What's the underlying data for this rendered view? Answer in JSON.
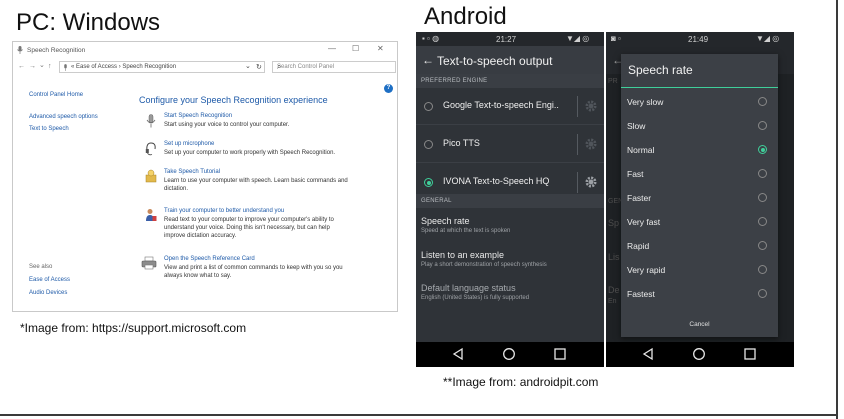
{
  "headings": {
    "pc": "PC: Windows",
    "android": "Android"
  },
  "credits": {
    "microsoft": "*Image from: https://support.microsoft.com",
    "androidpit": "**Image from: androidpit.com"
  },
  "windows": {
    "title": "Speech Recognition",
    "controls": {
      "minimize": "—",
      "maximize": "☐",
      "close": "✕"
    },
    "nav": {
      "back": "←",
      "forward": "→",
      "dropdown": "⌄",
      "up": "↑"
    },
    "breadcrumb": "« Ease of Access  ›  Speech Recognition",
    "breadcrumb_dropdown": "⌄",
    "refresh": "↻",
    "search_placeholder": "Search Control Panel",
    "help": "?",
    "sidebar": {
      "home": "Control Panel Home",
      "advanced": "Advanced speech options",
      "tts": "Text to Speech",
      "see_also": "See also",
      "ease": "Ease of Access",
      "audio": "Audio Devices"
    },
    "main_title": "Configure your Speech Recognition experience",
    "options": [
      {
        "head": "Start Speech Recognition",
        "desc": [
          "Start using your voice to control your computer."
        ]
      },
      {
        "head": "Set up microphone",
        "desc": [
          "Set up your computer to work properly with Speech Recognition."
        ]
      },
      {
        "head": "Take Speech Tutorial",
        "desc": [
          "Learn to use your computer with speech.  Learn basic commands and",
          "dictation."
        ]
      },
      {
        "head": "Train your computer to better understand you",
        "desc": [
          "Read text to your computer to improve your computer's ability to",
          "understand your voice. Doing this isn't necessary, but can help",
          "improve dictation accuracy."
        ]
      },
      {
        "head": "Open the Speech Reference Card",
        "desc": [
          "View and print a list of common commands to keep with you so you",
          "always know what to say."
        ]
      }
    ]
  },
  "android_left": {
    "time": "21:27",
    "title": "Text-to-speech output",
    "back_icon": "←",
    "preferred_engine": "PREFERRED ENGINE",
    "engines": [
      {
        "label": "Google Text-to-speech Engi..",
        "selected": false
      },
      {
        "label": "Pico TTS",
        "selected": false
      },
      {
        "label": "IVONA Text-to-Speech HQ",
        "selected": true
      }
    ],
    "general": "GENERAL",
    "settings": [
      {
        "title": "Speech rate",
        "sub": "Speed at which the text is spoken"
      },
      {
        "title": "Listen to an example",
        "sub": "Play a short demonstration of speech synthesis"
      },
      {
        "title": "Default language status",
        "sub": "English (United States) is fully supported"
      }
    ]
  },
  "android_right": {
    "time": "21:49",
    "dialog_title": "Speech rate",
    "rates": [
      {
        "label": "Very slow",
        "selected": false
      },
      {
        "label": "Slow",
        "selected": false
      },
      {
        "label": "Normal",
        "selected": true
      },
      {
        "label": "Fast",
        "selected": false
      },
      {
        "label": "Faster",
        "selected": false
      },
      {
        "label": "Very fast",
        "selected": false
      },
      {
        "label": "Rapid",
        "selected": false
      },
      {
        "label": "Very rapid",
        "selected": false
      },
      {
        "label": "Fastest",
        "selected": false
      }
    ],
    "cancel": "Cancel",
    "bg_fragments": [
      "PR",
      "GEN",
      "Sp",
      "Lis",
      "De",
      "En"
    ]
  },
  "colors": {
    "accent_green": "#3fcf9a",
    "link_blue": "#1e5aa8",
    "phone_bg": "#2f3338"
  }
}
